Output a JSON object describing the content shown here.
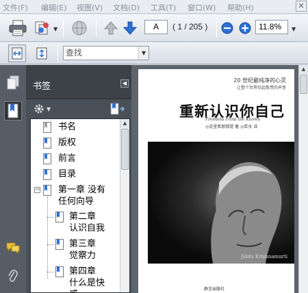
{
  "menu": {
    "items": [
      "文件(F)",
      "编辑(E)",
      "视图(V)",
      "文档(D)",
      "工具(T)",
      "窗口(W)",
      "帮助(H)"
    ],
    "close_glyph": "×"
  },
  "toolbar": {
    "page_number": "A",
    "page_count": "( 1 / 205 )",
    "zoom": "11.8%",
    "icons": [
      "print-icon",
      "share-icon",
      "globe-icon",
      "prev-page-icon",
      "next-page-icon",
      "zoom-out-icon",
      "zoom-in-icon"
    ]
  },
  "toolbar2": {
    "find_placeholder": "查找",
    "icons": [
      "fit-width-icon",
      "fit-page-icon"
    ]
  },
  "bookmarks": {
    "title": "书签",
    "items": [
      {
        "label": "书名",
        "level": 0
      },
      {
        "label": "版权",
        "level": 0
      },
      {
        "label": "前言",
        "level": 0
      },
      {
        "label": "目录",
        "level": 0
      },
      {
        "label": "第一章  没有",
        "label2": "任何向导",
        "level": 0,
        "expanded": true
      },
      {
        "label": "第二章",
        "label2": "认识自我",
        "level": 1
      },
      {
        "label": "第三章",
        "label2": "觉察力",
        "level": 1
      },
      {
        "label": "第四章",
        "label2": "什么是快",
        "label3": "感",
        "level": 1
      }
    ]
  },
  "cover": {
    "subtitle1": "20 世纪最纯净的心灵",
    "subtitle2": "让整个世界狂起敬畏的声音",
    "title": "重新认识你自己",
    "english": "Freedom From the Known",
    "author_line": "◎克里希那穆提 著 ◎若水 译",
    "photo_name": "Jiddu Krishnamurti",
    "publisher": "群言出版社"
  },
  "colors": {
    "accent_blue": "#2d6fd0",
    "panel_dark": "#4a5058",
    "doc_bg": "#5e646c"
  }
}
